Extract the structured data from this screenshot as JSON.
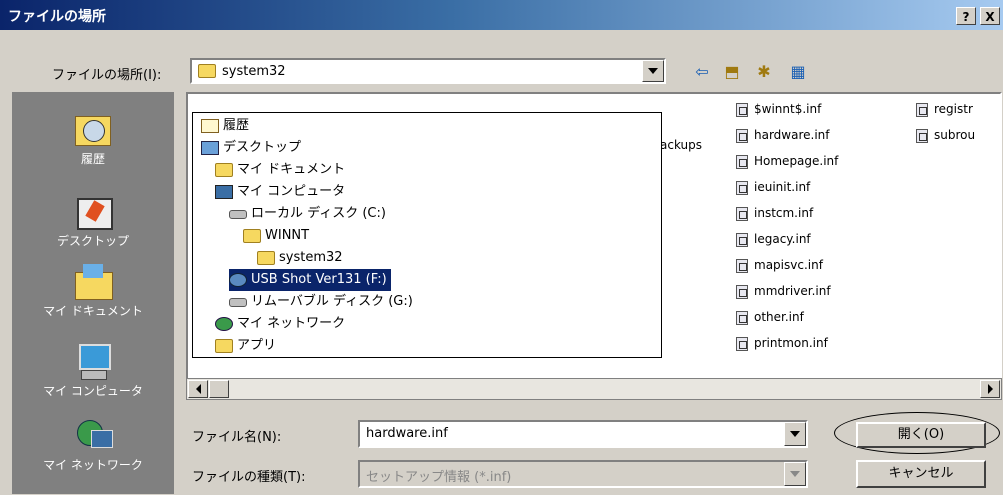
{
  "window": {
    "title": "ファイルの場所",
    "help_label": "?",
    "close_label": "X"
  },
  "location": {
    "label": "ファイルの場所(I):",
    "value": "system32"
  },
  "toolbar": {
    "back_glyph": "⇦",
    "up_glyph": "⬒",
    "newfolder_glyph": "✱",
    "view_glyph": "▦"
  },
  "places": [
    {
      "label": "履歴",
      "icon": "history-icon"
    },
    {
      "label": "デスクトップ",
      "icon": "desktop-icon"
    },
    {
      "label": "マイ ドキュメント",
      "icon": "my-documents-icon"
    },
    {
      "label": "マイ コンピュータ",
      "icon": "my-computer-icon"
    },
    {
      "label": "マイ ネットワーク",
      "icon": "my-network-icon"
    }
  ],
  "dropdown_items": [
    {
      "label": "履歴",
      "icon": "history"
    },
    {
      "label": "デスクトップ",
      "icon": "desktop"
    },
    {
      "label": "マイ ドキュメント",
      "icon": "folder"
    },
    {
      "label": "マイ コンピュータ",
      "icon": "computer"
    },
    {
      "label": "ローカル ディスク (C:)",
      "icon": "drive"
    },
    {
      "label": "WINNT",
      "icon": "folder"
    },
    {
      "label": "system32",
      "icon": "folder"
    },
    {
      "label": "USB Shot Ver131 (F:)",
      "icon": "usb",
      "selected": true
    },
    {
      "label": "リムーバブル ディスク (G:)",
      "icon": "drive"
    },
    {
      "label": "マイ ネットワーク",
      "icon": "network"
    },
    {
      "label": "アプリ",
      "icon": "folder"
    }
  ],
  "files": {
    "partial": "ackups",
    "col1": [
      "$winnt$.inf",
      "hardware.inf",
      "Homepage.inf",
      "ieuinit.inf",
      "instcm.inf",
      "legacy.inf",
      "mapisvc.inf",
      "mmdriver.inf",
      "other.inf",
      "printmon.inf"
    ],
    "col2": [
      "registr",
      "subrou"
    ]
  },
  "filename": {
    "label": "ファイル名(N):",
    "value": "hardware.inf"
  },
  "filetype": {
    "label": "ファイルの種類(T):",
    "value": "セットアップ情報 (*.inf)"
  },
  "buttons": {
    "open": "開く(O)",
    "cancel": "キャンセル"
  },
  "colors": {
    "title_start": "#0a246a",
    "title_end": "#a6caf0",
    "selection": "#0a246a",
    "face": "#d4d0c8"
  }
}
